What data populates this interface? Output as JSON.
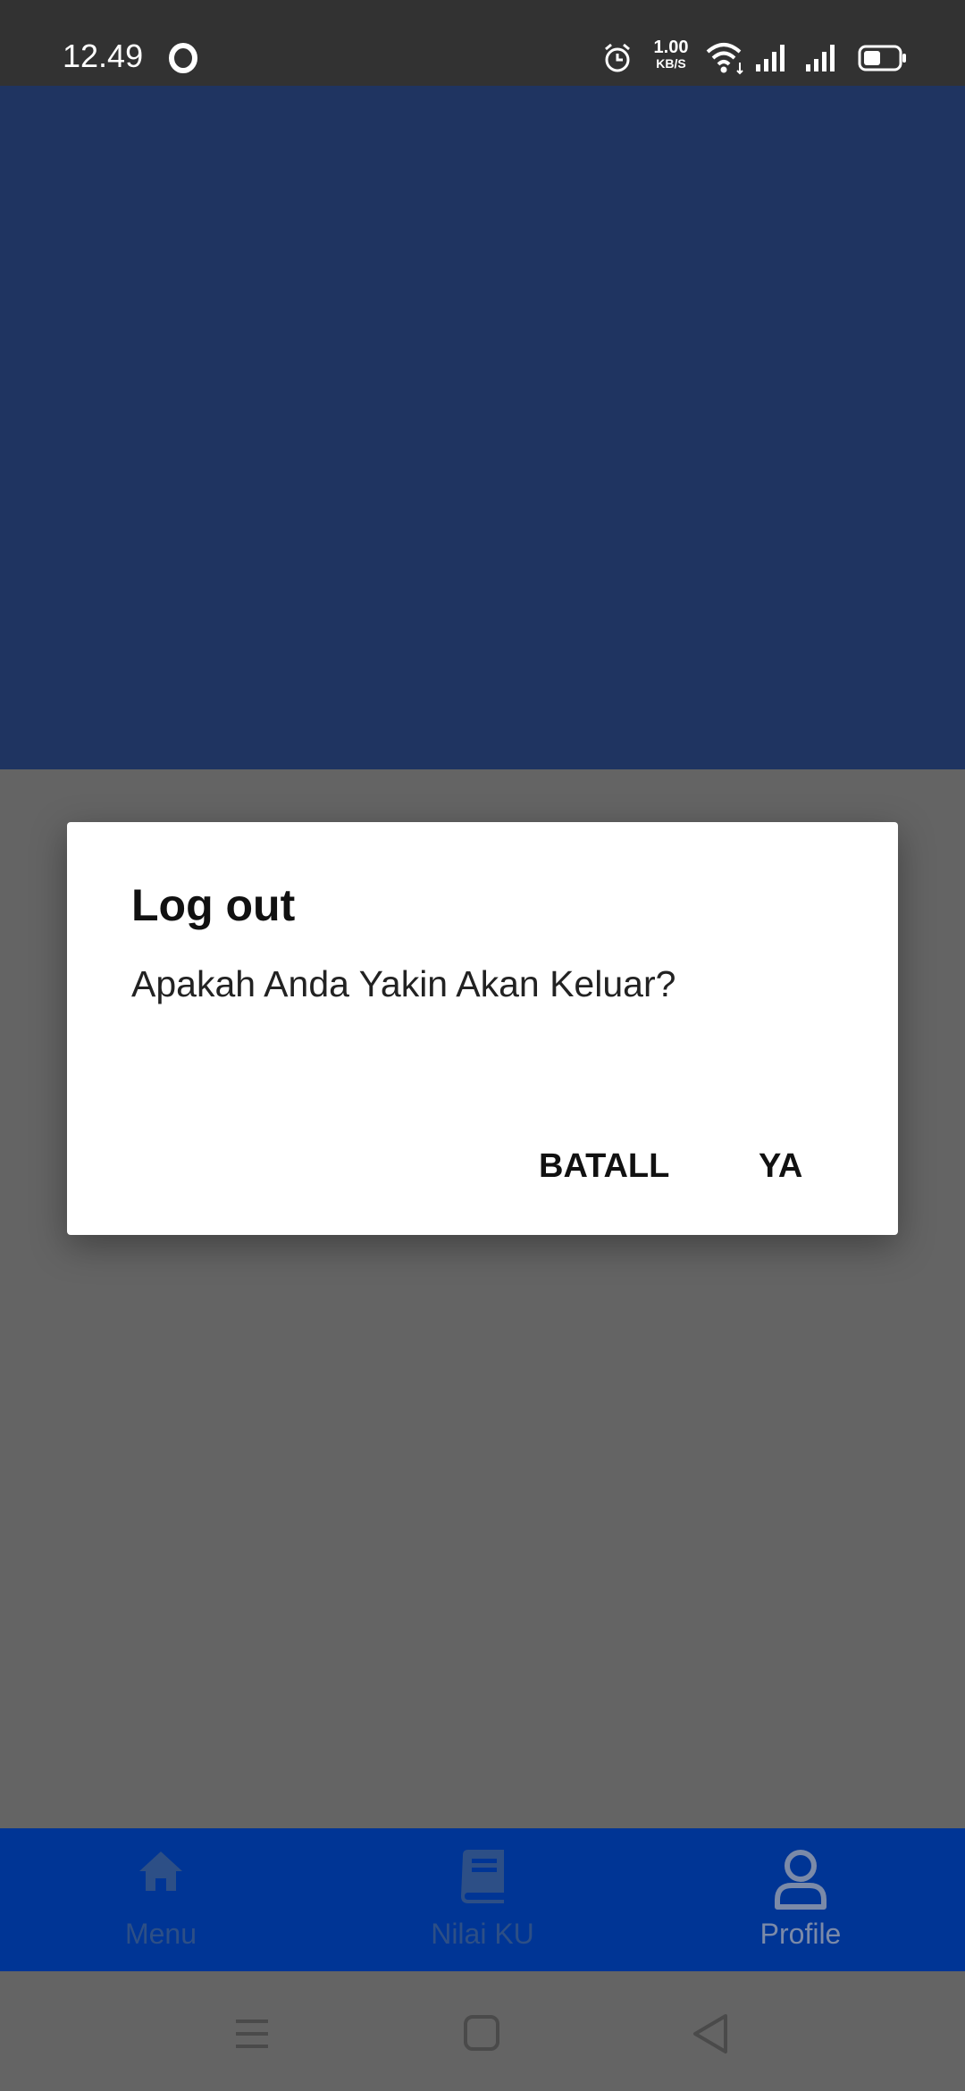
{
  "status_bar": {
    "time": "12.49",
    "net_speed_value": "1.00",
    "net_speed_unit": "KB/S",
    "icons": [
      "opera-icon",
      "alarm-icon",
      "wifi-icon",
      "signal-icon",
      "signal-icon",
      "battery-icon"
    ]
  },
  "dialog": {
    "title": "Log out",
    "message": "Apakah Anda Yakin Akan Keluar?",
    "cancel_label": "BATALL",
    "confirm_label": "YA"
  },
  "bottom_nav": {
    "items": [
      {
        "label": "Menu",
        "icon": "home-icon"
      },
      {
        "label": "Nilai KU",
        "icon": "book-icon"
      },
      {
        "label": "Profile",
        "icon": "person-icon"
      }
    ]
  },
  "system_nav": {
    "icons": [
      "recent-apps-icon",
      "home-button-icon",
      "back-icon"
    ]
  },
  "colors": {
    "status_bar": "#323232",
    "header": "#1f3461",
    "scrim_body": "#646464",
    "bottom_nav": "#003595",
    "dialog_bg": "#ffffff"
  }
}
